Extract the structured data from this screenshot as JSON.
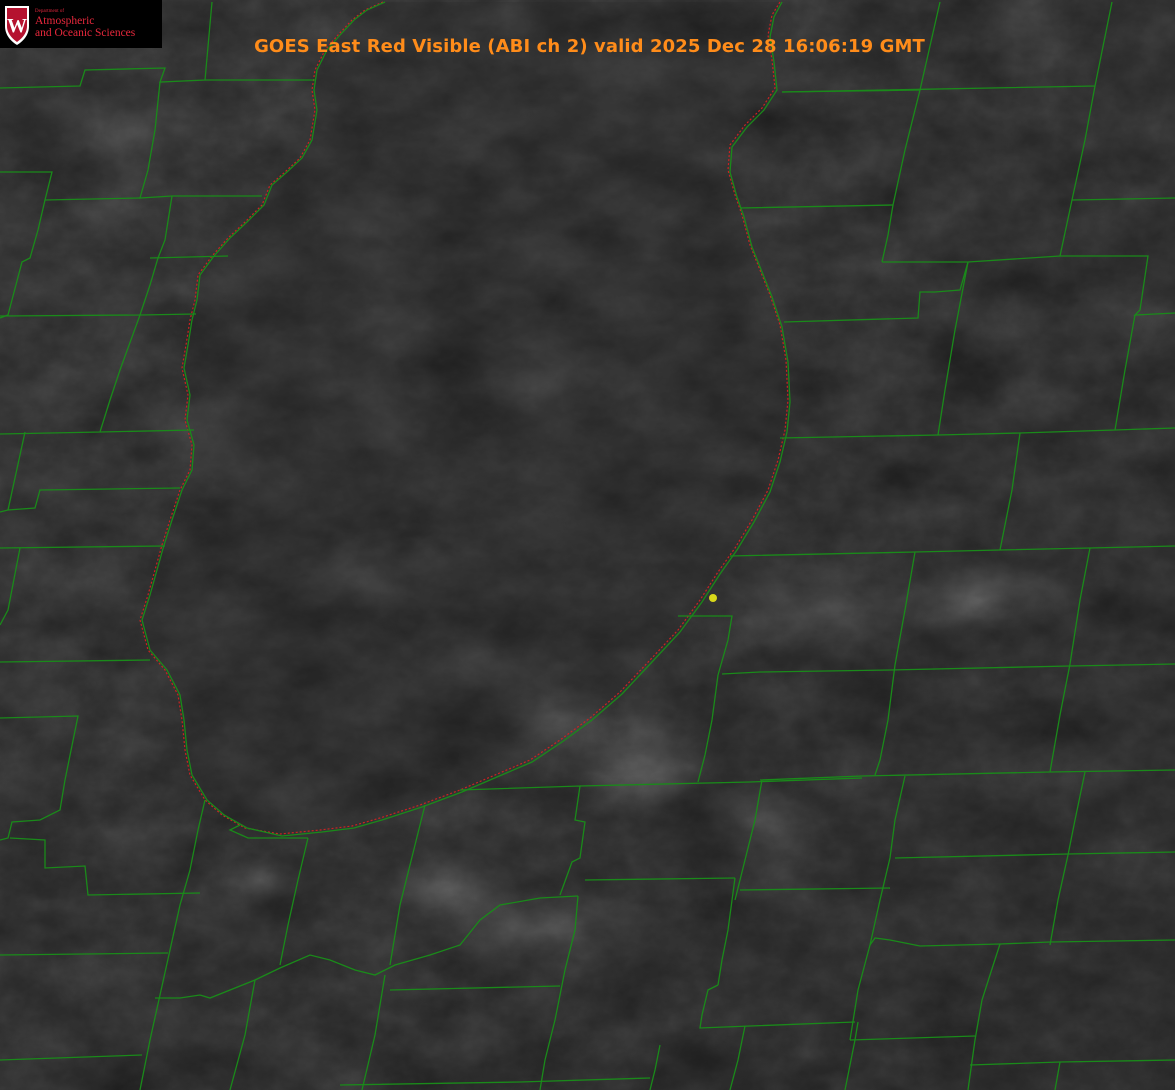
{
  "product": {
    "title": "GOES East Red Visible (ABI ch 2) valid 2025 Dec 28 16:06:19 GMT"
  },
  "logo": {
    "badge_letter": "W",
    "department_line": "Department of",
    "name_line1": "Atmospheric",
    "name_line2": "and Oceanic Sciences",
    "icon": "uw-crest-icon"
  },
  "colors": {
    "title": "#ff8c1a",
    "county_borders": "#1a8a1a",
    "shoreline": "#cc2222",
    "station_marker": "#d8d81a",
    "logo_text": "#e8283c",
    "logo_badge": "#b5122f"
  }
}
